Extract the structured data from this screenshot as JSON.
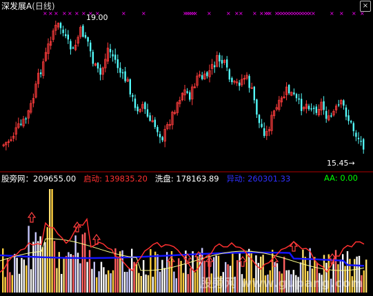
{
  "header": {
    "title": "深发展A",
    "period": "(日线)",
    "close_symbol": "×"
  },
  "price_chart": {
    "high_label": "19.00",
    "low_label": "15.45",
    "arrow": "→",
    "marker_glyph": "×"
  },
  "indicator": {
    "site_label": "股旁网：",
    "site_value": "209655.00",
    "start_label": "启动:",
    "start_value": "139835.20",
    "wash_label": "洗盘:",
    "wash_value": "178163.89",
    "move_label": "异动:",
    "move_value": "260301.33",
    "aa_label": "AA:",
    "aa_value": "0.00"
  },
  "watermark": "股旁网 www.gupang.com",
  "colors": {
    "background": "#000000",
    "up_candle": "#ff3c3c",
    "down_candle": "#54fcfc",
    "marker": "#ff00ff",
    "separator": "#b00000",
    "blue_line": "#1414ff",
    "yellow_line": "#ffff8c",
    "red_line": "#ff3030",
    "start_color": "#ff3030",
    "wash_color": "#ffffff",
    "move_color": "#3030ff",
    "aa_color": "#00ff00"
  },
  "chart_data": {
    "type": "candlestick",
    "title": "深发展A (日线)",
    "ylim": [
      15.0,
      19.5
    ],
    "annotations": [
      "19.00 (high)",
      "15.45 (low)"
    ]
  }
}
